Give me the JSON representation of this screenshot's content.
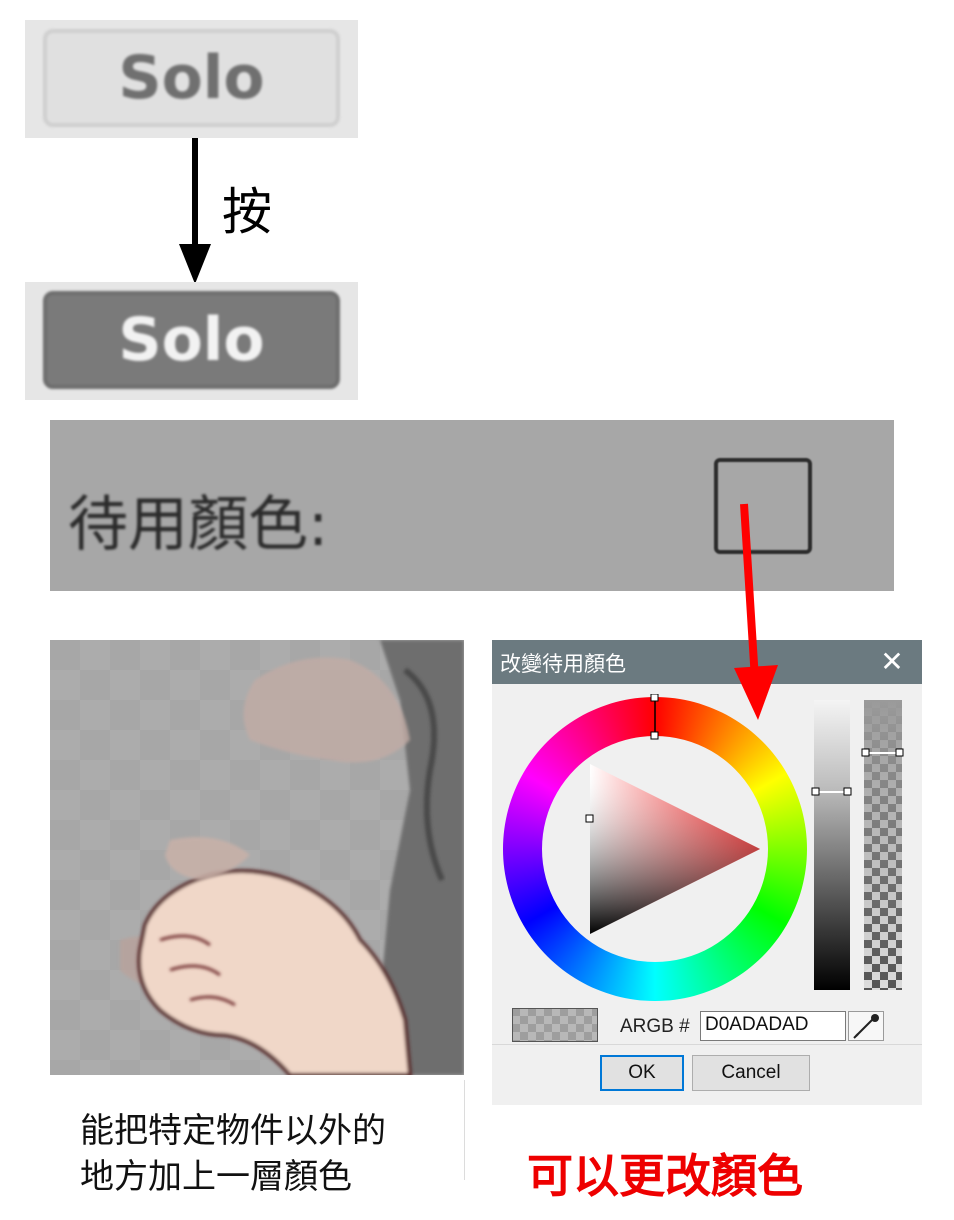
{
  "solo_button": {
    "label_off": "Solo",
    "label_on": "Solo"
  },
  "press_label": "按",
  "standby": {
    "label": "待用顏色:",
    "swatch_color": "#a7a7a7"
  },
  "dialog": {
    "title": "改變待用顏色",
    "close_glyph": "✕",
    "argb_label": "ARGB #",
    "argb_value": "D0ADADAD",
    "ok_label": "OK",
    "cancel_label": "Cancel"
  },
  "captions": {
    "left_line1": "能把特定物件以外的",
    "left_line2": "地方加上一層顏色",
    "note": "可以更改顏色"
  },
  "colors": {
    "arrow_black": "#000000",
    "arrow_red": "#ff0000",
    "title_bar": "#6b7a80",
    "note_red": "#ee0000"
  }
}
